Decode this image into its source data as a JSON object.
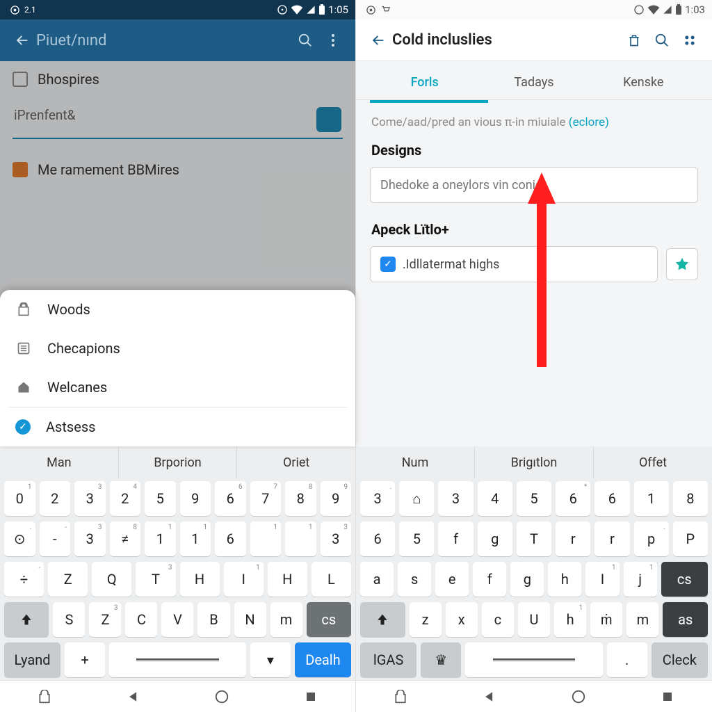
{
  "left": {
    "status": {
      "small": "2.1",
      "time": "1:05"
    },
    "appbar": {
      "title": "Piuet/nınd"
    },
    "bg": {
      "item1": "Bhospires",
      "input": "iPrenfent",
      "inputGlyph": "&",
      "item2": "Me ramement BBMires"
    },
    "sheet": {
      "r1": "Woods",
      "r2": "Checapions",
      "r3": "Welcanes",
      "r4": "Astsess"
    },
    "keyboard": {
      "suggestions": [
        "Man",
        "Brporion",
        "Oriet"
      ],
      "row1": [
        {
          "main": "0",
          "sup": "1"
        },
        {
          "main": "2"
        },
        {
          "main": "3",
          "sup": "3"
        },
        {
          "main": "2",
          "sup": "4"
        },
        {
          "main": "5"
        },
        {
          "main": "9"
        },
        {
          "main": "6",
          "sup": "6"
        },
        {
          "main": "7",
          "sup": "7"
        },
        {
          "main": "8",
          "sup": "8"
        },
        {
          "main": "9",
          "sup": "9"
        }
      ],
      "row2": [
        {
          "main": "⊙",
          "sup": "."
        },
        {
          "main": "-",
          "sup": "-"
        },
        {
          "main": "3",
          "sup": "3"
        },
        {
          "main": "≠",
          "sup": "8"
        },
        {
          "main": "1",
          "sup": "1"
        },
        {
          "main": "1",
          "sup": "1"
        },
        {
          "main": "6"
        },
        {
          "main": "",
          "sup": "1"
        },
        {
          "main": "",
          "sup": "1"
        },
        {
          "main": "3",
          "sup": "3"
        }
      ],
      "row3": [
        {
          "main": "÷",
          "sup": "-"
        },
        {
          "main": "Z"
        },
        {
          "main": "Q"
        },
        {
          "main": "T",
          "sup": "3"
        },
        {
          "main": "H"
        },
        {
          "main": "I",
          "sup": "1"
        },
        {
          "main": "H"
        },
        {
          "main": "L"
        }
      ],
      "row4": {
        "shift": "⇧",
        "keys": [
          {
            "main": "S"
          },
          {
            "main": "Z",
            "sup": "3"
          },
          {
            "main": "C"
          },
          {
            "main": "V"
          },
          {
            "main": "B"
          },
          {
            "main": "N"
          },
          {
            "main": "m"
          }
        ],
        "bksp": "cs"
      },
      "row5": {
        "lang": "Lyand",
        "plus": "+",
        "drop": "▾",
        "enter": "Dealh"
      }
    }
  },
  "right": {
    "status": {
      "time": "1:03"
    },
    "appbar": {
      "title": "Cold incluslies"
    },
    "tabs": [
      "Forls",
      "Tadays",
      "Kenske"
    ],
    "hint_text": "Come/aad/pred an vious π-in miuiale",
    "hint_link": "(eclore)",
    "sec1_label": "Designs",
    "sec1_placeholder": "Dhedoke a oneylors vin conid",
    "sec2_label": "Apeck Lïtlo+",
    "sec2_value": ".Idllatermat highs",
    "keyboard": {
      "suggestions": [
        "Num",
        "Brigıtlon",
        "Offet"
      ],
      "row1": [
        {
          "main": "3",
          "sup": "."
        },
        {
          "main": "⌂"
        },
        {
          "main": "3"
        },
        {
          "main": "4"
        },
        {
          "main": "5"
        },
        {
          "main": "6",
          "sup": "*"
        },
        {
          "main": "6"
        },
        {
          "main": "1"
        },
        {
          "main": "8"
        }
      ],
      "row2": [
        {
          "main": "6"
        },
        {
          "main": "5"
        },
        {
          "main": "f"
        },
        {
          "main": "g"
        },
        {
          "main": "T"
        },
        {
          "main": "r"
        },
        {
          "main": "r"
        },
        {
          "main": "p",
          "sup": "."
        },
        {
          "main": "P"
        }
      ],
      "row3": {
        "keys": [
          {
            "main": "a"
          },
          {
            "main": "s"
          },
          {
            "main": "e"
          },
          {
            "main": "f"
          },
          {
            "main": "g"
          },
          {
            "main": "h"
          },
          {
            "main": "I",
            "sup": "1"
          },
          {
            "main": "j",
            "sup": "1"
          }
        ],
        "bksp": "cs"
      },
      "row4": {
        "shift": "⇧",
        "keys": [
          {
            "main": "z"
          },
          {
            "main": "x"
          },
          {
            "main": "c"
          },
          {
            "main": "U"
          },
          {
            "main": "h",
            "sup": "1"
          },
          {
            "main": "ṁ"
          },
          {
            "main": "m"
          }
        ],
        "bksp": "as"
      },
      "row5": {
        "lang": "lGAS",
        "crown": "♛",
        "enter": "Cleck"
      }
    }
  }
}
